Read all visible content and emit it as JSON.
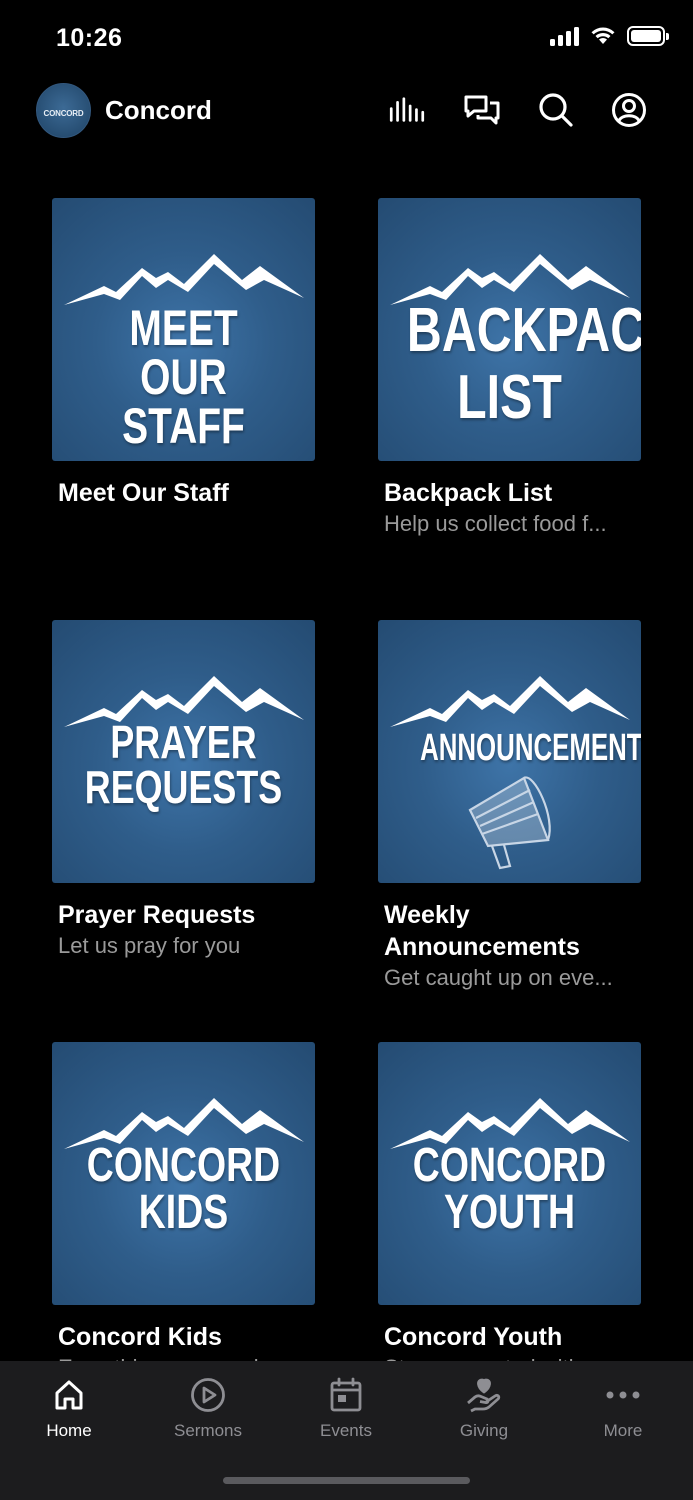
{
  "status": {
    "time": "10:26"
  },
  "header": {
    "title": "Concord",
    "logo_text": "CONCORD"
  },
  "cards": [
    {
      "image_text": "MEET OUR\nSTAFF",
      "title": "Meet Our Staff",
      "subtitle": ""
    },
    {
      "image_text": "BACKPACK\nLIST",
      "title": "Backpack List",
      "subtitle": "Help us collect food f..."
    },
    {
      "image_text": "PRAYER\nREQUESTS",
      "title": "Prayer Requests",
      "subtitle": "Let us pray for you"
    },
    {
      "image_text": "ANNOUNCEMENTS",
      "title": "Weekly Announcements",
      "subtitle": "Get caught up on eve..."
    },
    {
      "image_text": "CONCORD\nKIDS",
      "title": "Concord Kids",
      "subtitle": "Everything you need"
    },
    {
      "image_text": "CONCORD\nYOUTH",
      "title": "Concord Youth",
      "subtitle": "Stay connected with"
    }
  ],
  "tabs": [
    {
      "label": "Home",
      "icon": "home-icon"
    },
    {
      "label": "Sermons",
      "icon": "play-circle-icon"
    },
    {
      "label": "Events",
      "icon": "calendar-icon"
    },
    {
      "label": "Giving",
      "icon": "giving-hand-heart-icon"
    },
    {
      "label": "More",
      "icon": "more-dots-icon"
    }
  ],
  "colors": {
    "tile_blue": "#2f5d8a",
    "tab_bar": "#1c1c1e",
    "inactive": "#8e8e93"
  }
}
